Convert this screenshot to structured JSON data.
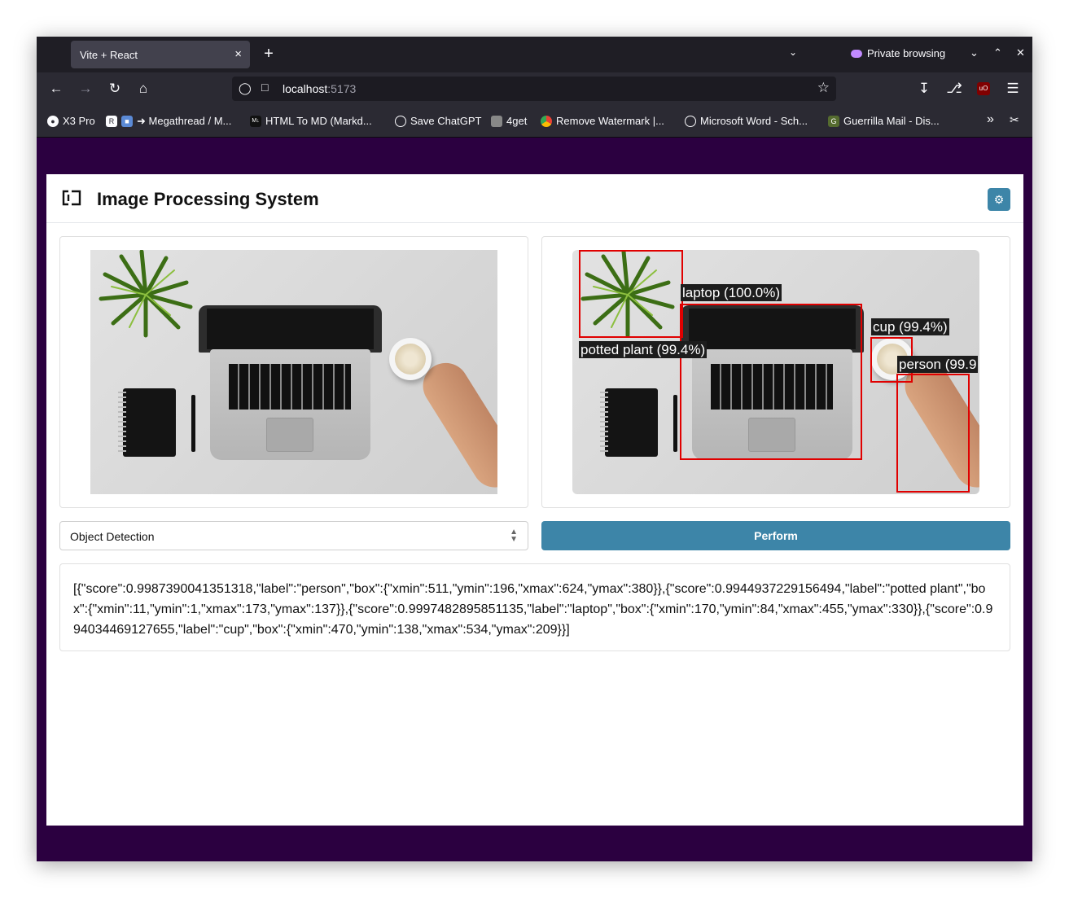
{
  "browser": {
    "tab_title": "Vite + React",
    "tab_close": "×",
    "new_tab": "+",
    "private_label": "Private browsing",
    "url_host": "localhost",
    "url_port": ":5173",
    "bookmarks": [
      {
        "label": "X3 Pro",
        "icon": "x3-icon"
      },
      {
        "label": "➜ Megathread / M...",
        "icon": "reddit-icon"
      },
      {
        "label": "HTML To MD (Markd...",
        "icon": "md-icon"
      },
      {
        "label": "Save ChatGPT",
        "icon": "globe-icon"
      },
      {
        "label": "4get",
        "icon": "4get-icon"
      },
      {
        "label": "Remove Watermark |...",
        "icon": "chrome-icon"
      },
      {
        "label": "Microsoft Word - Sch...",
        "icon": "globe-icon"
      },
      {
        "label": "Guerrilla Mail - Dis...",
        "icon": "guerrilla-icon"
      }
    ]
  },
  "app": {
    "title": "Image Processing System",
    "task_select_value": "Object Detection",
    "perform_label": "Perform",
    "output_text": "[{\"score\":0.9987390041351318,\"label\":\"person\",\"box\":{\"xmin\":511,\"ymin\":196,\"xmax\":624,\"ymax\":380}},{\"score\":0.9944937229156494,\"label\":\"potted plant\",\"box\":{\"xmin\":11,\"ymin\":1,\"xmax\":173,\"ymax\":137}},{\"score\":0.9997482895851135,\"label\":\"laptop\",\"box\":{\"xmin\":170,\"ymin\":84,\"xmax\":455,\"ymax\":330}},{\"score\":0.994034469127655,\"label\":\"cup\",\"box\":{\"xmin\":470,\"ymin\":138,\"xmax\":534,\"ymax\":209}}]",
    "detections": [
      {
        "name": "laptop",
        "label": "laptop (100.0%)"
      },
      {
        "name": "potted-plant",
        "label": "potted plant (99.4%)"
      },
      {
        "name": "cup",
        "label": "cup (99.4%)"
      },
      {
        "name": "person",
        "label": "person (99.9"
      }
    ],
    "accent_color": "#3d85a8",
    "box_color": "#e00000",
    "page_background": "#2b0040"
  }
}
